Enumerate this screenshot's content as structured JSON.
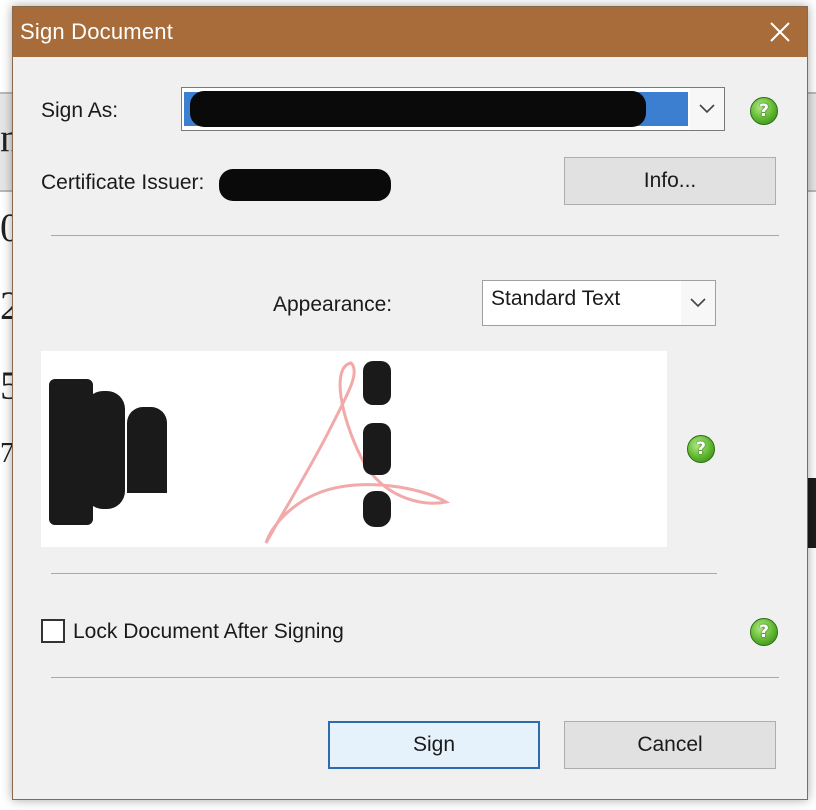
{
  "dialog": {
    "title": "Sign Document",
    "sign_as_label": "Sign As:",
    "certificate_issuer_label": "Certificate Issuer:",
    "info_button": "Info...",
    "appearance_label": "Appearance:",
    "appearance_value": "Standard Text",
    "lock_label": "Lock Document After Signing",
    "lock_checked": false,
    "sign_button": "Sign",
    "cancel_button": "Cancel"
  },
  "icons": {
    "close": "close-icon",
    "dropdown": "chevron-down-icon",
    "help": "help-icon"
  },
  "colors": {
    "titlebar": "#a86c3a",
    "help_green": "#5cb52e",
    "selection_blue": "#3c7fd0"
  }
}
